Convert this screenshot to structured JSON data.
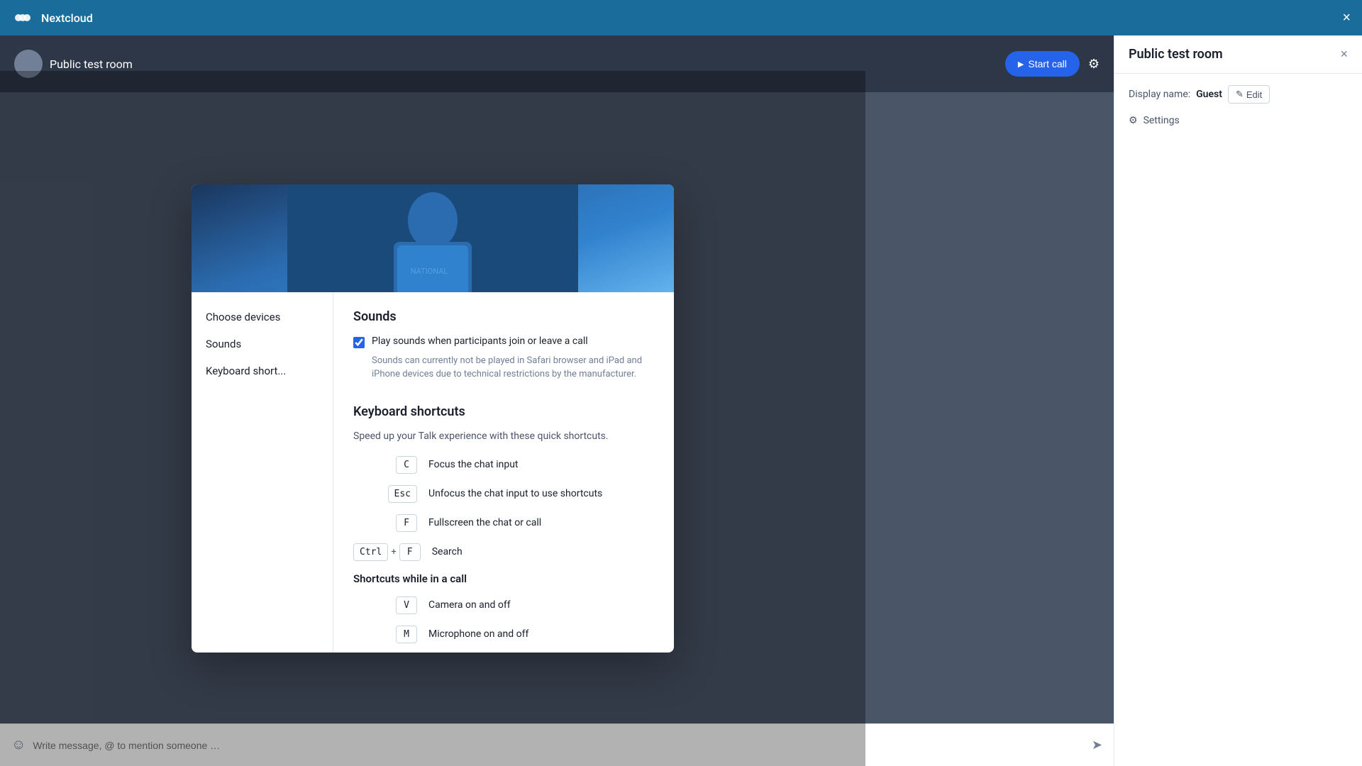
{
  "topbar": {
    "app_name": "Nextcloud",
    "close_label": "×"
  },
  "room": {
    "name": "Public test room",
    "start_call_label": "Start call",
    "chat_placeholder": "Write message, @ to mention someone …",
    "send_icon": "➤"
  },
  "sidebar": {
    "title": "Public test room",
    "close_label": "×",
    "display_name_label": "Display name:",
    "display_name_value": "Guest",
    "edit_label": "Edit",
    "settings_label": "Settings"
  },
  "modal": {
    "nav": {
      "choose_devices": "Choose devices",
      "sounds": "Sounds",
      "keyboard_shortcuts": "Keyboard short..."
    },
    "sounds_section": {
      "title": "Sounds",
      "checkbox_checked": true,
      "checkbox_label": "Play sounds when participants join or leave a call",
      "checkbox_description": "Sounds can currently not be played in Safari browser and iPad and iPhone devices due to technical restrictions by the manufacturer."
    },
    "keyboard_section": {
      "title": "Keyboard shortcuts",
      "description": "Speed up your Talk experience with these quick shortcuts.",
      "shortcuts": [
        {
          "keys": [
            "C"
          ],
          "description": "Focus the chat input"
        },
        {
          "keys": [
            "Esc"
          ],
          "description": "Unfocus the chat input to use shortcuts"
        },
        {
          "keys": [
            "F"
          ],
          "description": "Fullscreen the chat or call"
        },
        {
          "keys": [
            "Ctrl",
            "+",
            "F"
          ],
          "description": "Search"
        }
      ],
      "shortcuts_call_title": "Shortcuts while in a call",
      "shortcuts_call": [
        {
          "keys": [
            "V"
          ],
          "description": "Camera on and off"
        },
        {
          "keys": [
            "M"
          ],
          "description": "Microphone on and off"
        }
      ]
    }
  },
  "icons": {
    "logo": "⊙",
    "gear": "⚙",
    "emoji": "☺",
    "edit_pencil": "✎",
    "settings_gear": "⚙"
  }
}
